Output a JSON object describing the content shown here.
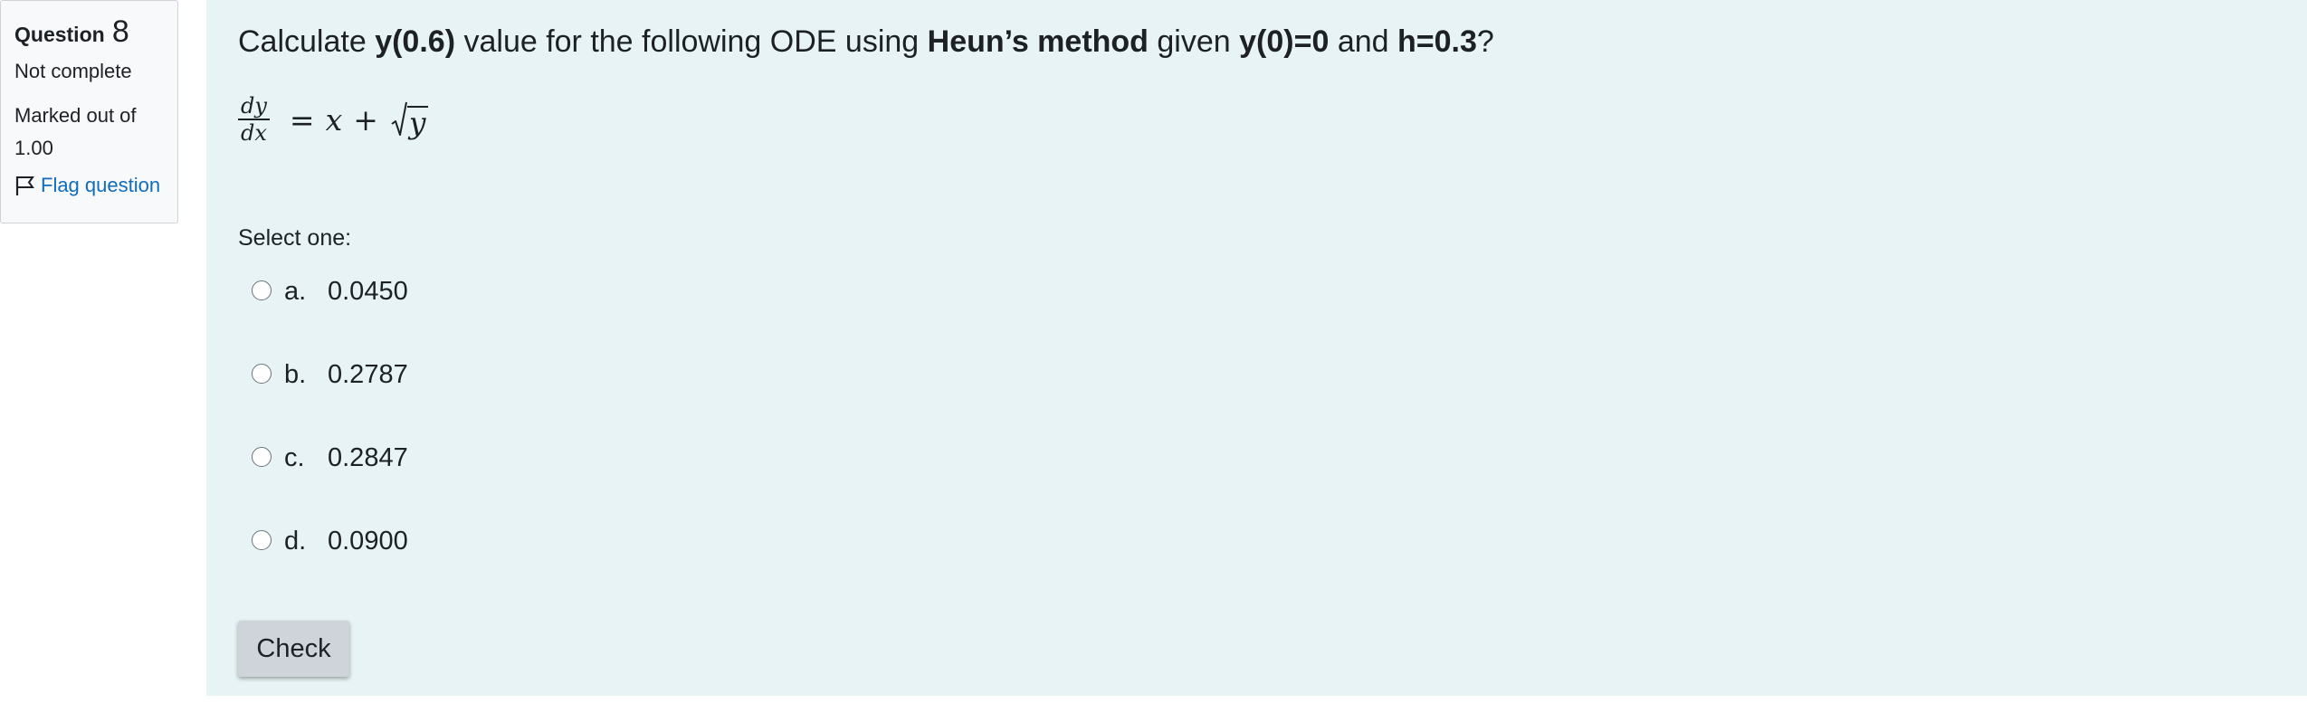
{
  "info": {
    "question_label": "Question",
    "question_number": "8",
    "state": "Not complete",
    "grade": "Marked out of 1.00",
    "flag_label": "Flag question"
  },
  "question": {
    "text_parts": [
      {
        "text": "Calculate ",
        "bold": false
      },
      {
        "text": "y(0.6)",
        "bold": true
      },
      {
        "text": " value for the following ODE using ",
        "bold": false
      },
      {
        "text": "Heun’s method",
        "bold": true
      },
      {
        "text": " given ",
        "bold": false
      },
      {
        "text": "y(0)=0",
        "bold": true
      },
      {
        "text": " and ",
        "bold": false
      },
      {
        "text": "h=0.3",
        "bold": true
      },
      {
        "text": "?",
        "bold": false
      }
    ],
    "equation": {
      "numerator": "dy",
      "denominator": "dx",
      "equals": "=",
      "term1": "x",
      "plus": "+",
      "radicand": "y"
    },
    "prompt": "Select one:",
    "answers": [
      {
        "letter": "a.",
        "value": "0.0450"
      },
      {
        "letter": "b.",
        "value": "0.2787"
      },
      {
        "letter": "c.",
        "value": "0.2847"
      },
      {
        "letter": "d.",
        "value": "0.0900"
      }
    ]
  },
  "check_button": "Check",
  "colors": {
    "content_bg": "#e7f3f5",
    "info_bg": "#f8f9fa",
    "link": "#0f6cbf",
    "button_bg": "#ced4da"
  },
  "icons": {
    "flag": "flag-icon",
    "radio": "radio-unchecked"
  }
}
